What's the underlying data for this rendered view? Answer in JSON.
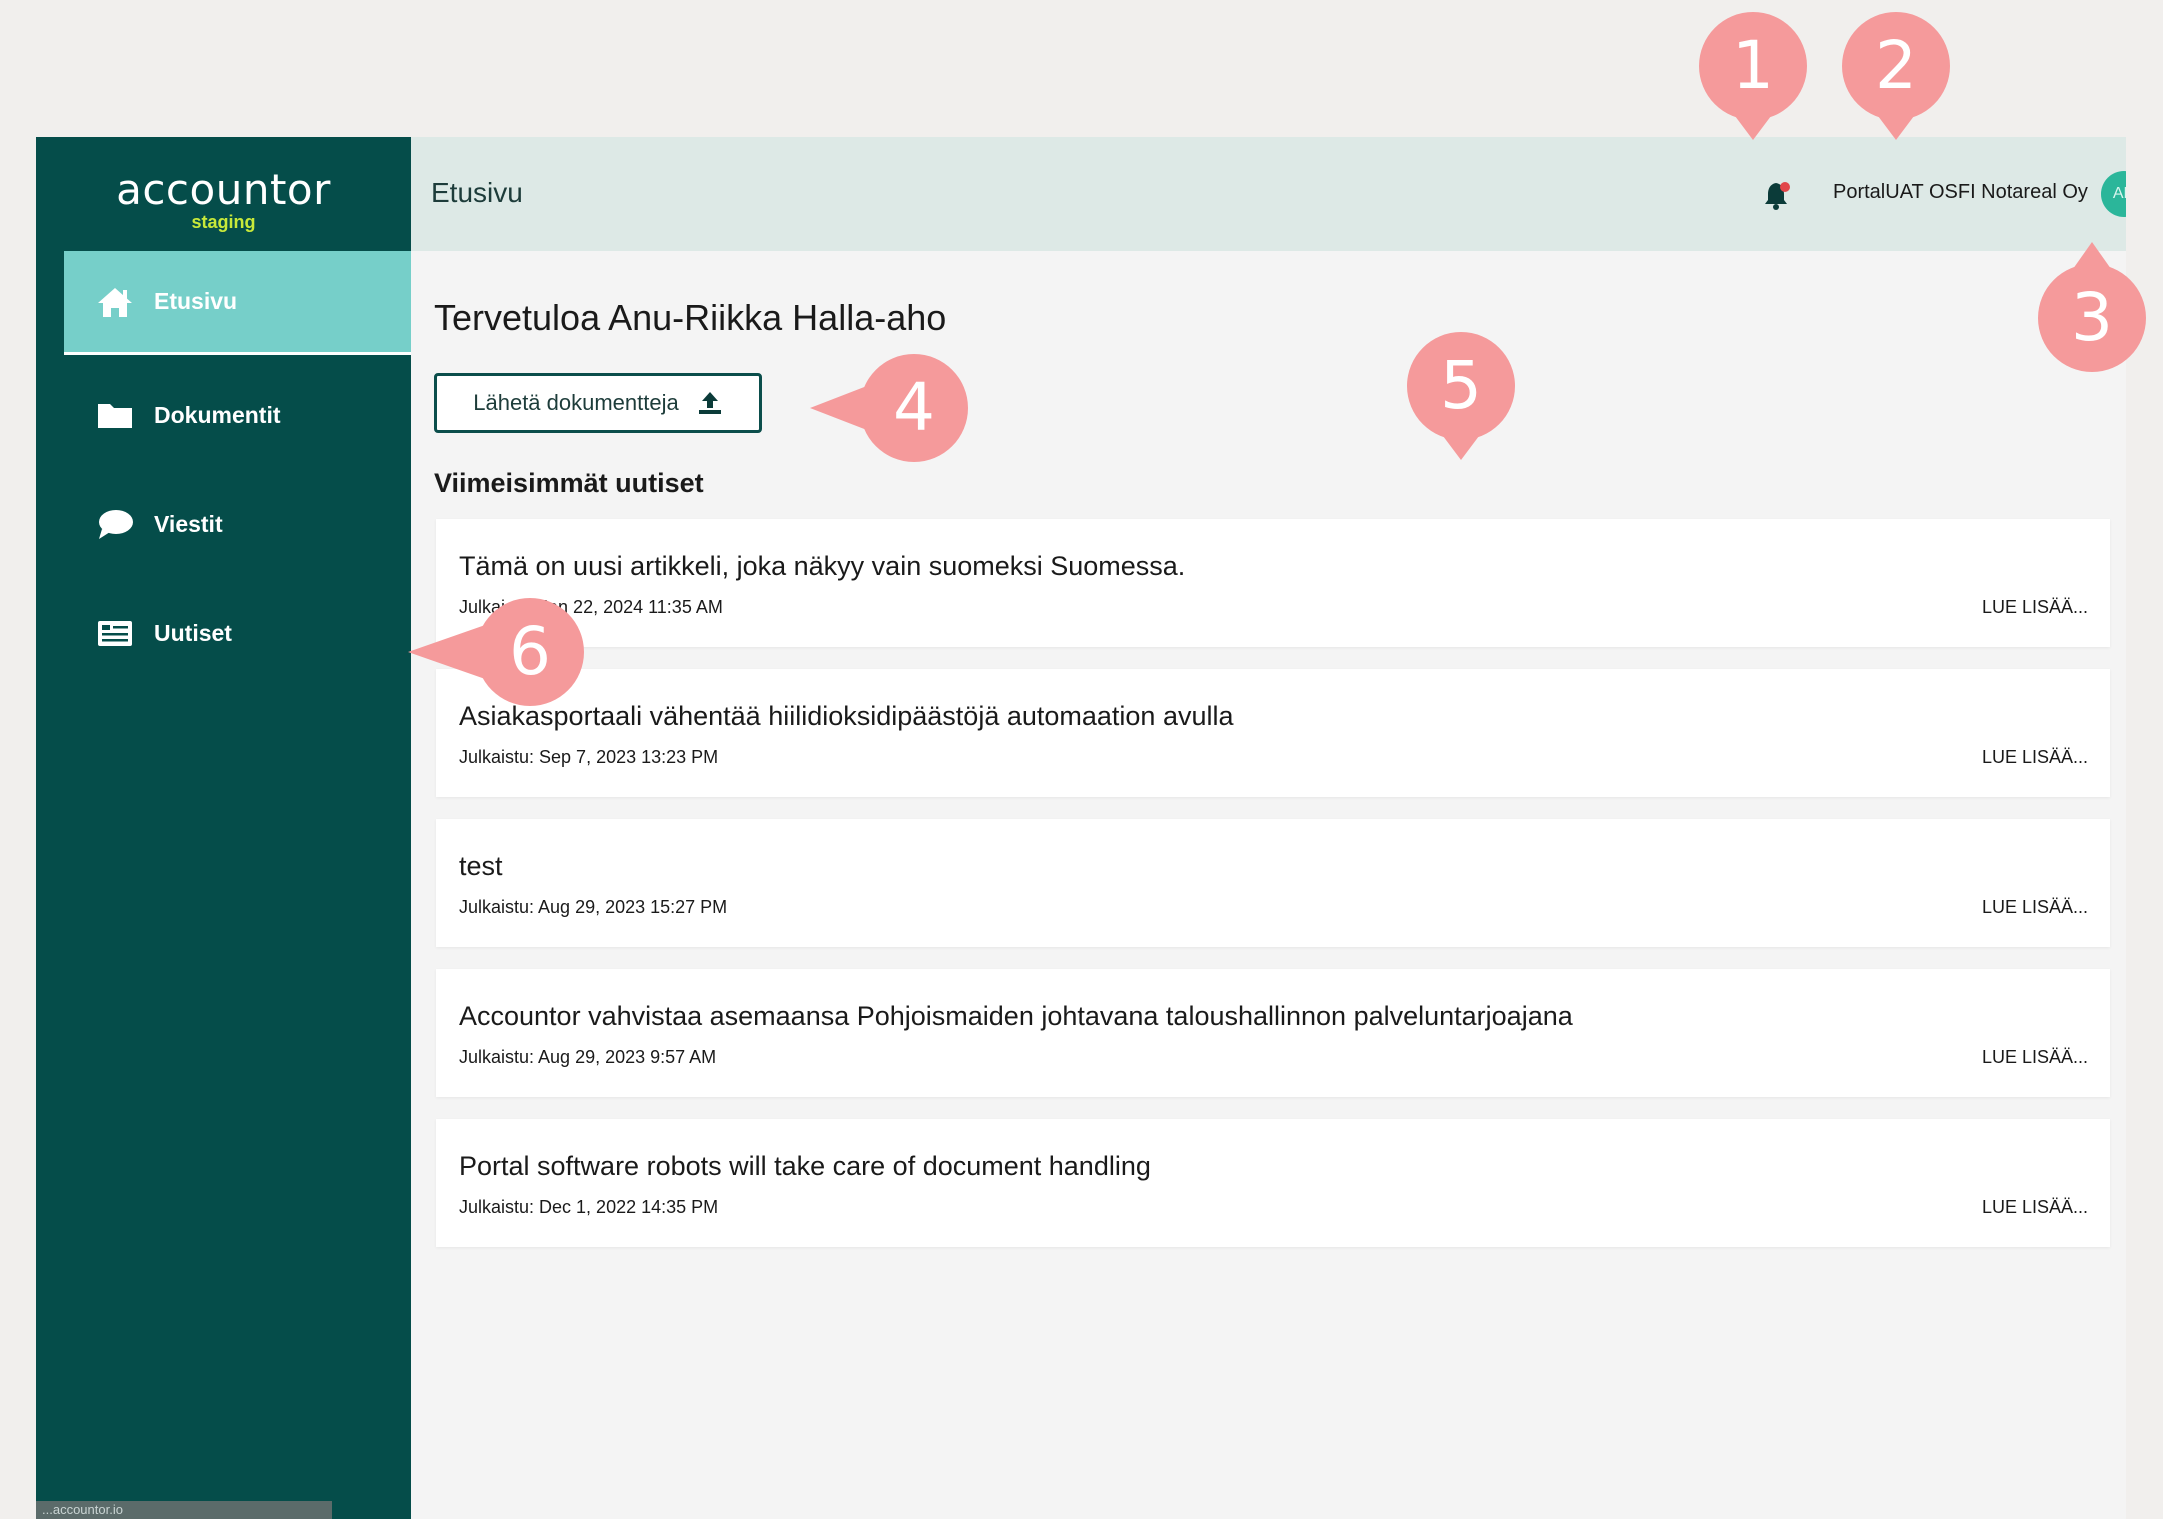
{
  "app": {
    "logo_text": "accountor",
    "logo_sub": "staging",
    "status_bar_text": "...accountor.io"
  },
  "sidebar": {
    "items": [
      {
        "label": "Etusivu",
        "icon": "home-icon",
        "active": true
      },
      {
        "label": "Dokumentit",
        "icon": "folder-icon",
        "active": false
      },
      {
        "label": "Viestit",
        "icon": "chat-bubble-icon",
        "active": false
      },
      {
        "label": "Uutiset",
        "icon": "newspaper-icon",
        "active": false
      }
    ]
  },
  "header": {
    "title": "Etusivu",
    "notification_icon": "bell-icon",
    "company_name": "PortalUAT OSFI Notareal Oy",
    "avatar_initials": "AH"
  },
  "main": {
    "welcome": "Tervetuloa Anu-Riikka Halla-aho",
    "upload_button_label": "Lähetä dokumentteja",
    "upload_icon": "upload-icon",
    "news_heading": "Viimeisimmät uutiset",
    "news": [
      {
        "title": "Tämä on uusi artikkeli, joka näkyy vain suomeksi Suomessa.",
        "date": "Julkaistu: Jan 22, 2024 11:35 AM",
        "read_more": "LUE LISÄÄ..."
      },
      {
        "title": "Asiakasportaali vähentää hiilidioksidipäästöjä automaation avulla",
        "date": "Julkaistu: Sep 7, 2023 13:23 PM",
        "read_more": "LUE LISÄÄ..."
      },
      {
        "title": "test",
        "date": "Julkaistu: Aug 29, 2023 15:27 PM",
        "read_more": "LUE LISÄÄ..."
      },
      {
        "title": "Accountor vahvistaa asemaansa Pohjoismaiden johtavana taloushallinnon palveluntarjoajana",
        "date": "Julkaistu: Aug 29, 2023 9:57 AM",
        "read_more": "LUE LISÄÄ..."
      },
      {
        "title": "Portal software robots will take care of document handling",
        "date": "Julkaistu: Dec 1, 2022 14:35 PM",
        "read_more": "LUE LISÄÄ..."
      }
    ]
  },
  "callouts": [
    {
      "number": "1",
      "pointer": "down"
    },
    {
      "number": "2",
      "pointer": "down"
    },
    {
      "number": "3",
      "pointer": "up"
    },
    {
      "number": "4",
      "pointer": "left"
    },
    {
      "number": "5",
      "pointer": "down"
    },
    {
      "number": "6",
      "pointer": "left"
    }
  ],
  "colors": {
    "sidebar_bg": "#054d4a",
    "sidebar_active": "#76cfc9",
    "header_bg": "#dde9e6",
    "callout": "#f59a9b",
    "avatar_bg": "#2bb69a",
    "logo_accent": "#c8e93a"
  }
}
